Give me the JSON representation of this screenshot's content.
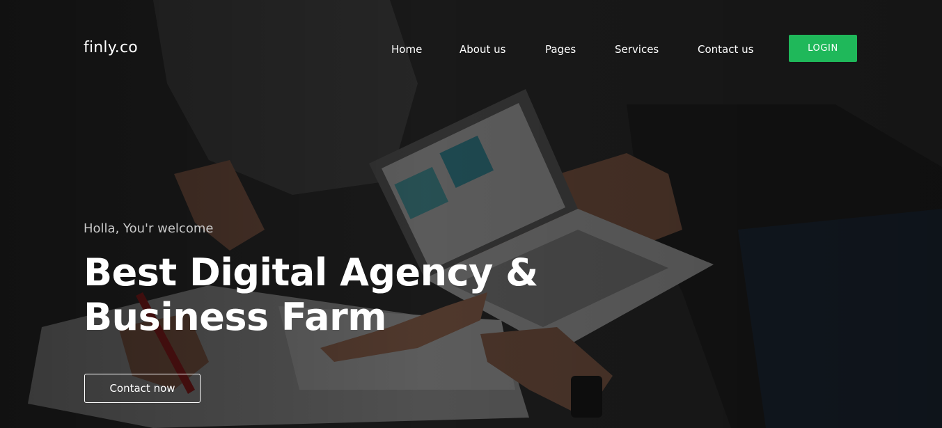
{
  "header": {
    "logo": "finly.co",
    "nav": {
      "home": "Home",
      "about": "About us",
      "pages": "Pages",
      "services": "Services",
      "contact": "Contact us"
    },
    "login_label": "LOGIN"
  },
  "hero": {
    "eyebrow": "Holla, You'r welcome",
    "headline_line1": "Best Digital Agency &",
    "headline_line2": "Business Farm",
    "cta_label": "Contact now"
  },
  "colors": {
    "accent": "#1fb85a",
    "text": "#ffffff",
    "overlay": "#1b1b1b"
  }
}
